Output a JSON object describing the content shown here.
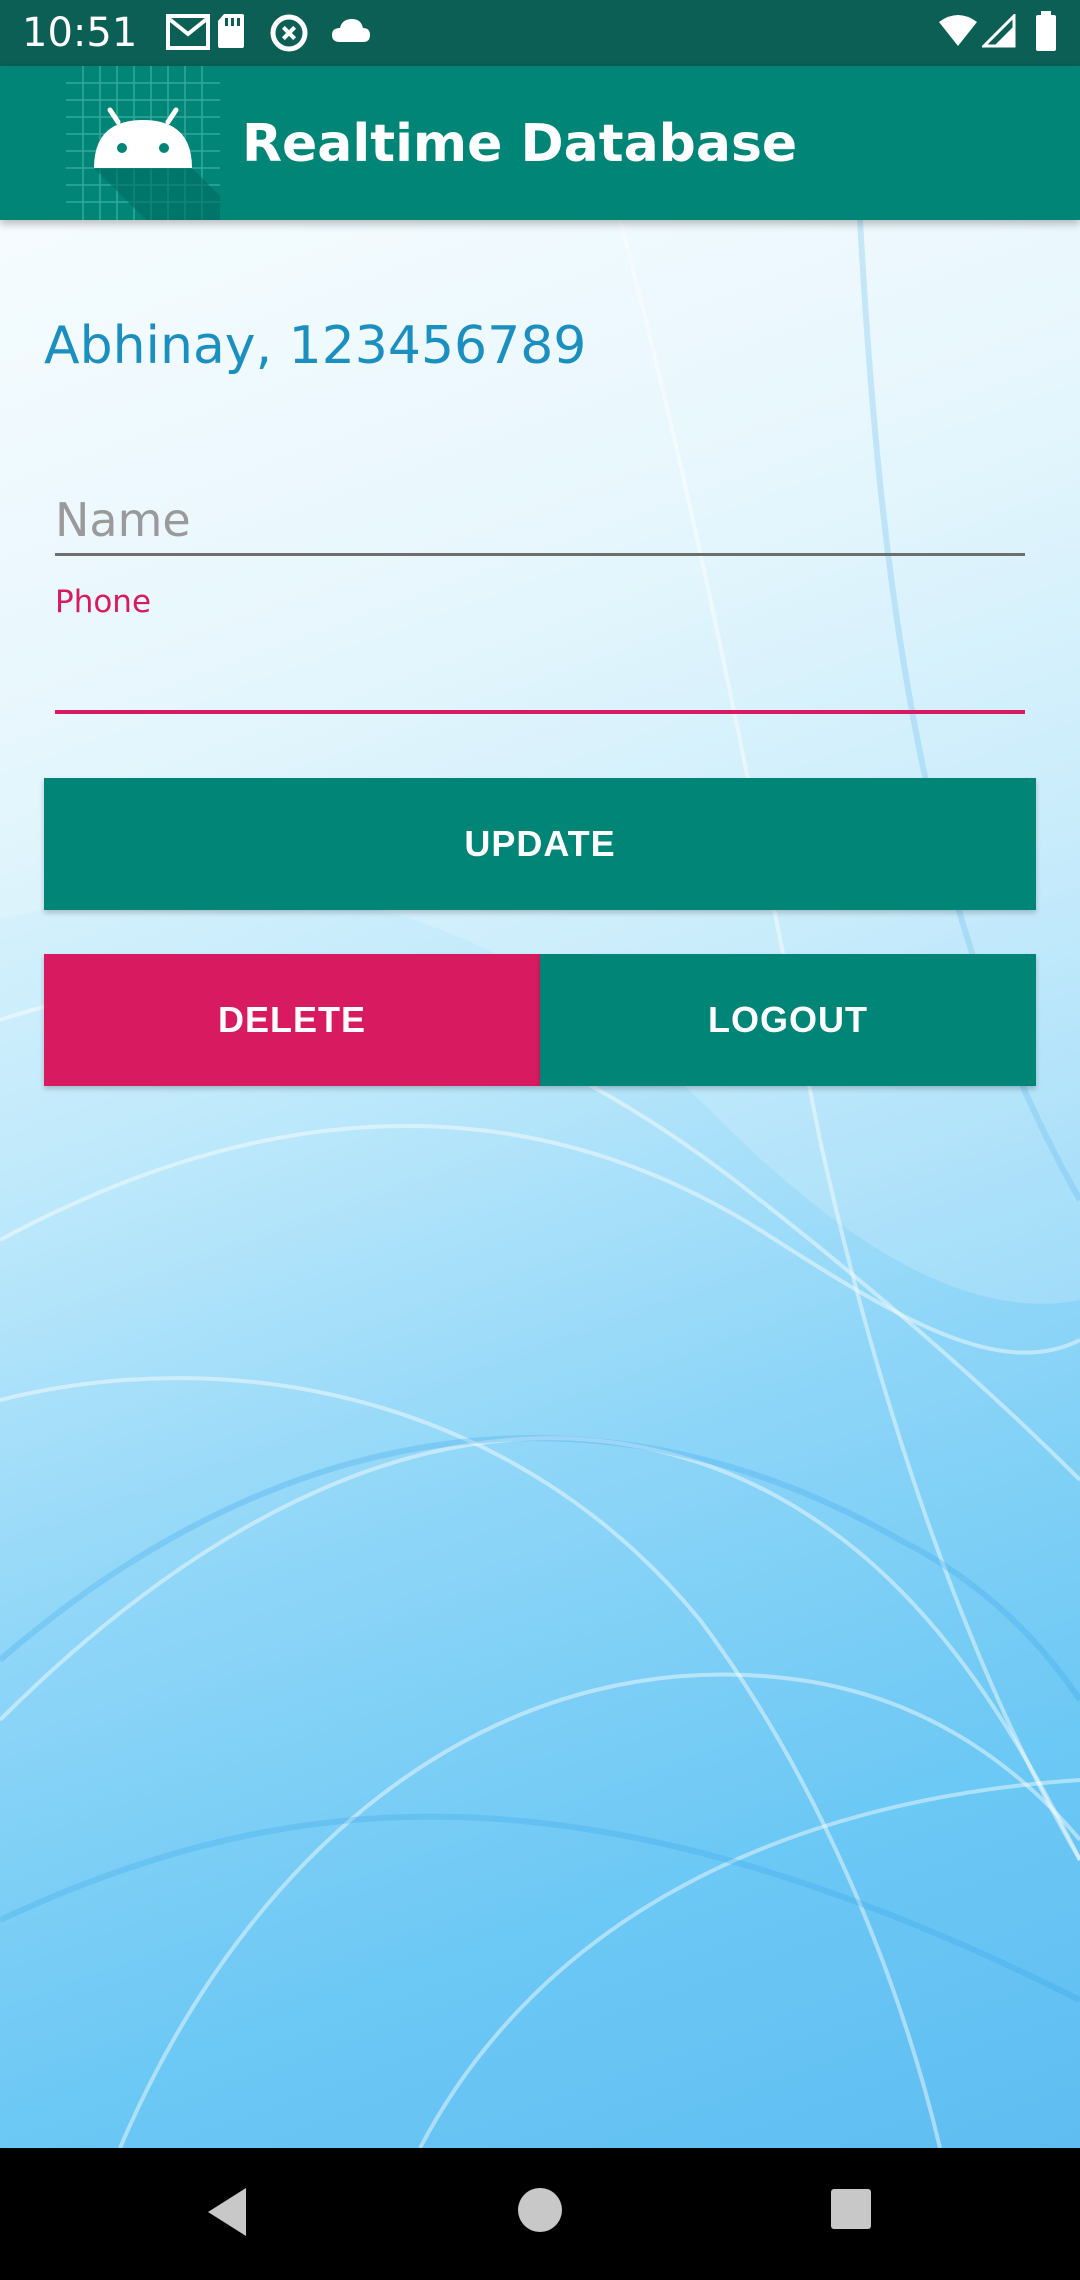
{
  "status_bar": {
    "time": "10:51",
    "left_icons": [
      "gmail-icon",
      "sd-card-icon",
      "data-saver-icon",
      "cloud-icon"
    ],
    "right_icons": [
      "wifi-icon",
      "cellular-signal-icon",
      "battery-icon"
    ]
  },
  "app_bar": {
    "title": "Realtime Database",
    "logo_icon": "android-icon",
    "color": "#008577"
  },
  "main": {
    "user_line": "Abhinay, 123456789",
    "name_field": {
      "placeholder": "Name",
      "value": ""
    },
    "phone_field": {
      "label": "Phone",
      "value": ""
    },
    "buttons": {
      "update": "UPDATE",
      "delete": "DELETE",
      "logout": "LOGOUT"
    }
  },
  "colors": {
    "primary": "#008577",
    "accent": "#D81B60",
    "user_text": "#1B8FC0"
  },
  "nav_bar": {
    "icons": [
      "back-icon",
      "home-icon",
      "recents-icon"
    ]
  }
}
